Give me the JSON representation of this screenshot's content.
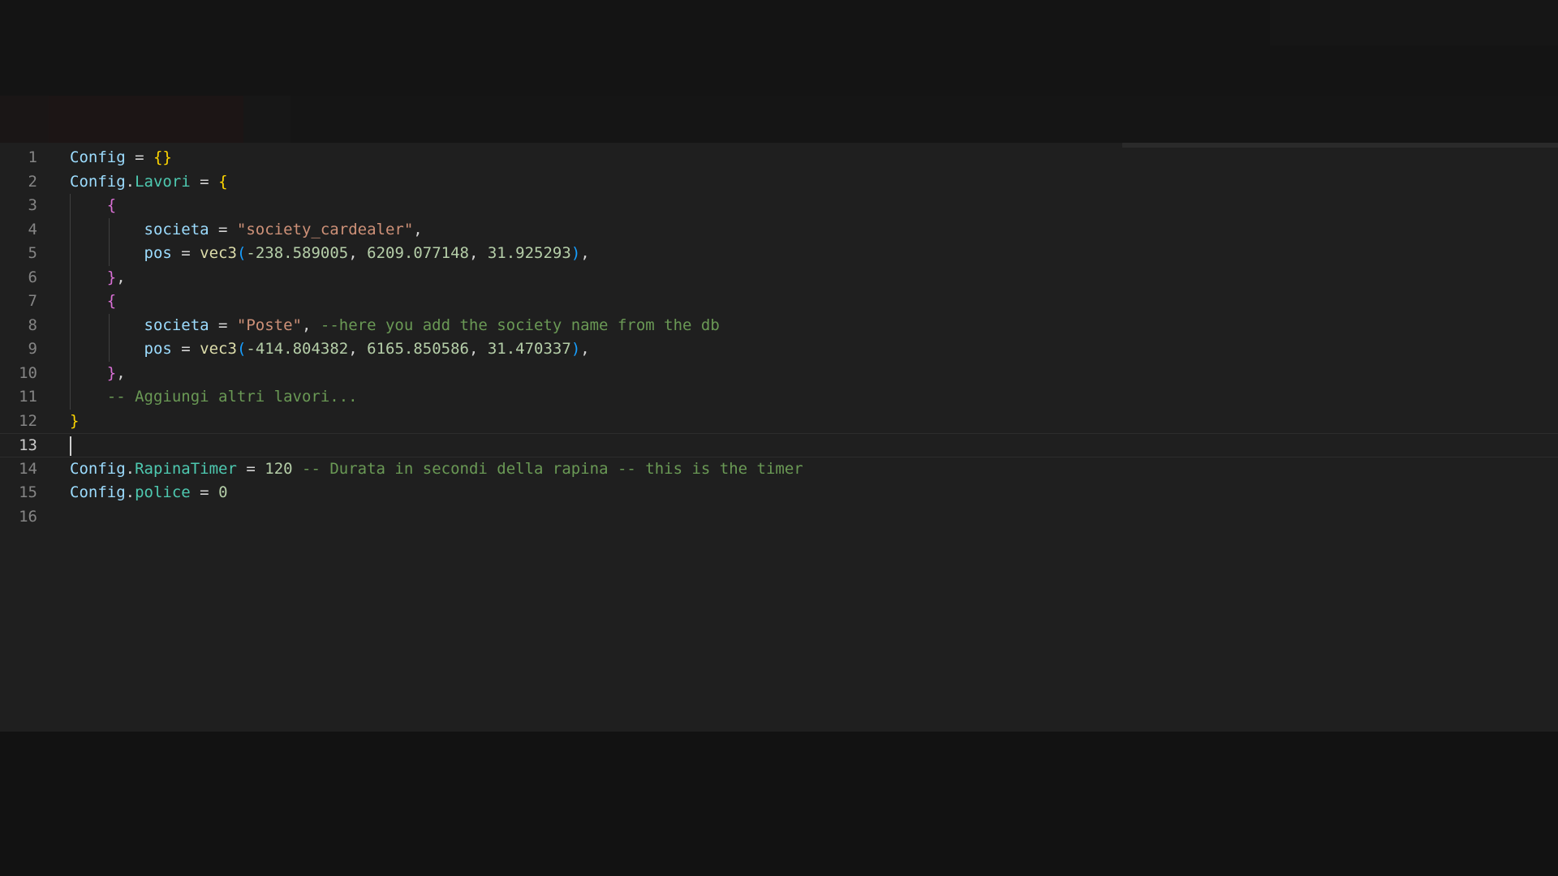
{
  "colors": {
    "background": "#1f1f1f",
    "comment": "#6a9955",
    "string": "#ce9178",
    "number": "#b5cea8",
    "variable": "#9cdcfe",
    "field": "#4ec9b0",
    "bracket_level1": "#ffd700",
    "bracket_level2": "#da70d6",
    "bracket_level3": "#179fff"
  },
  "editor": {
    "current_line": 13,
    "lines": [
      {
        "num": "1",
        "tokens": [
          {
            "t": "Config",
            "c": "var"
          },
          {
            "t": " = ",
            "c": "op"
          },
          {
            "t": "{}",
            "c": "br1"
          }
        ]
      },
      {
        "num": "2",
        "tokens": [
          {
            "t": "Config",
            "c": "var"
          },
          {
            "t": ".",
            "c": "op"
          },
          {
            "t": "Lavori",
            "c": "field"
          },
          {
            "t": " = ",
            "c": "op"
          },
          {
            "t": "{",
            "c": "br1"
          }
        ]
      },
      {
        "num": "3",
        "tokens": [
          {
            "t": "    ",
            "c": "text"
          },
          {
            "t": "{",
            "c": "br2"
          }
        ]
      },
      {
        "num": "4",
        "tokens": [
          {
            "t": "        ",
            "c": "text"
          },
          {
            "t": "societa",
            "c": "var"
          },
          {
            "t": " = ",
            "c": "op"
          },
          {
            "t": "\"society_cardealer\"",
            "c": "str"
          },
          {
            "t": ",",
            "c": "op"
          }
        ]
      },
      {
        "num": "5",
        "tokens": [
          {
            "t": "        ",
            "c": "text"
          },
          {
            "t": "pos",
            "c": "var"
          },
          {
            "t": " = ",
            "c": "op"
          },
          {
            "t": "vec3",
            "c": "fn"
          },
          {
            "t": "(",
            "c": "br3"
          },
          {
            "t": "-238.589005",
            "c": "num"
          },
          {
            "t": ", ",
            "c": "op"
          },
          {
            "t": "6209.077148",
            "c": "num"
          },
          {
            "t": ", ",
            "c": "op"
          },
          {
            "t": "31.925293",
            "c": "num"
          },
          {
            "t": ")",
            "c": "br3"
          },
          {
            "t": ",",
            "c": "op"
          }
        ]
      },
      {
        "num": "6",
        "tokens": [
          {
            "t": "    ",
            "c": "text"
          },
          {
            "t": "}",
            "c": "br2"
          },
          {
            "t": ",",
            "c": "op"
          }
        ]
      },
      {
        "num": "7",
        "tokens": [
          {
            "t": "    ",
            "c": "text"
          },
          {
            "t": "{",
            "c": "br2"
          }
        ]
      },
      {
        "num": "8",
        "tokens": [
          {
            "t": "        ",
            "c": "text"
          },
          {
            "t": "societa",
            "c": "var"
          },
          {
            "t": " = ",
            "c": "op"
          },
          {
            "t": "\"Poste\"",
            "c": "str"
          },
          {
            "t": ", ",
            "c": "op"
          },
          {
            "t": "--here you add the society name from the db",
            "c": "com"
          }
        ]
      },
      {
        "num": "9",
        "tokens": [
          {
            "t": "        ",
            "c": "text"
          },
          {
            "t": "pos",
            "c": "var"
          },
          {
            "t": " = ",
            "c": "op"
          },
          {
            "t": "vec3",
            "c": "fn"
          },
          {
            "t": "(",
            "c": "br3"
          },
          {
            "t": "-414.804382",
            "c": "num"
          },
          {
            "t": ", ",
            "c": "op"
          },
          {
            "t": "6165.850586",
            "c": "num"
          },
          {
            "t": ", ",
            "c": "op"
          },
          {
            "t": "31.470337",
            "c": "num"
          },
          {
            "t": ")",
            "c": "br3"
          },
          {
            "t": ",",
            "c": "op"
          }
        ]
      },
      {
        "num": "10",
        "tokens": [
          {
            "t": "    ",
            "c": "text"
          },
          {
            "t": "}",
            "c": "br2"
          },
          {
            "t": ",",
            "c": "op"
          }
        ]
      },
      {
        "num": "11",
        "tokens": [
          {
            "t": "    ",
            "c": "text"
          },
          {
            "t": "-- Aggiungi altri lavori...",
            "c": "com"
          }
        ]
      },
      {
        "num": "12",
        "tokens": [
          {
            "t": "}",
            "c": "br1"
          }
        ]
      },
      {
        "num": "13",
        "tokens": []
      },
      {
        "num": "14",
        "tokens": [
          {
            "t": "Config",
            "c": "var"
          },
          {
            "t": ".",
            "c": "op"
          },
          {
            "t": "RapinaTimer",
            "c": "field"
          },
          {
            "t": " = ",
            "c": "op"
          },
          {
            "t": "120",
            "c": "num"
          },
          {
            "t": " ",
            "c": "text"
          },
          {
            "t": "-- Durata in secondi della rapina -- this is the timer",
            "c": "com"
          }
        ]
      },
      {
        "num": "15",
        "tokens": [
          {
            "t": "Config",
            "c": "var"
          },
          {
            "t": ".",
            "c": "op"
          },
          {
            "t": "police",
            "c": "field"
          },
          {
            "t": " = ",
            "c": "op"
          },
          {
            "t": "0",
            "c": "num"
          }
        ]
      },
      {
        "num": "16",
        "tokens": []
      }
    ]
  }
}
